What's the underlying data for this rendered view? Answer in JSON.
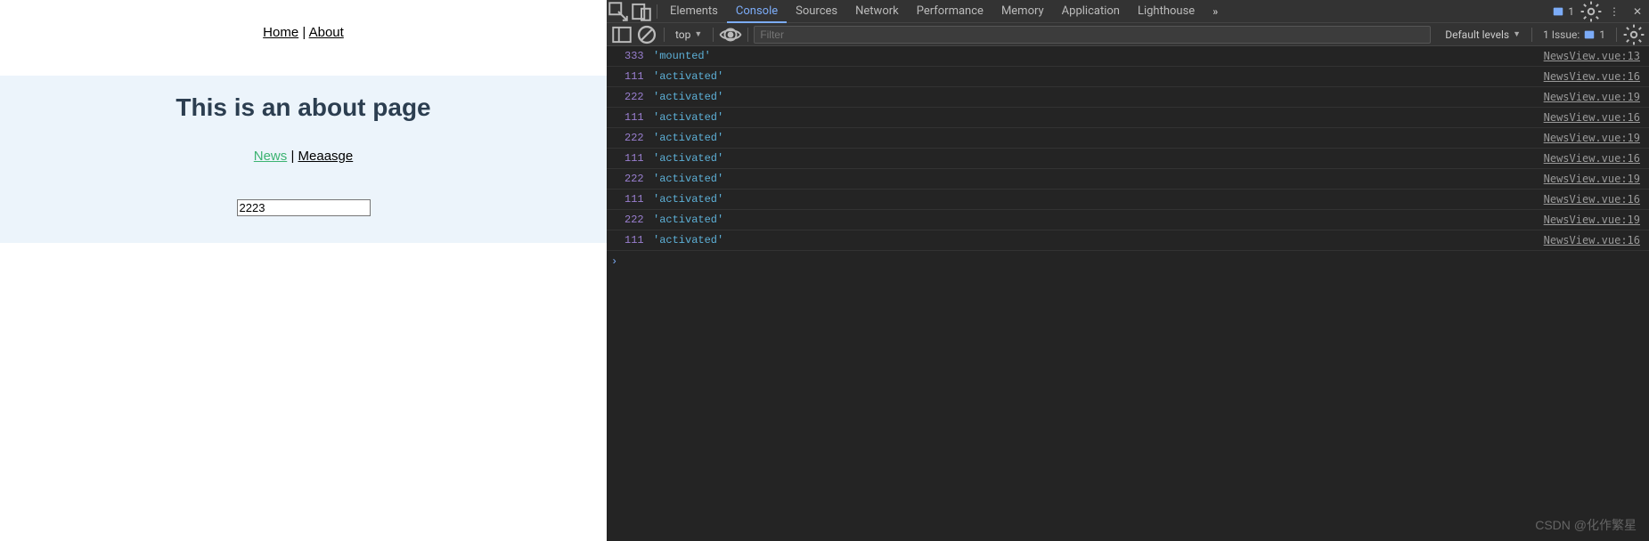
{
  "app": {
    "nav": {
      "home": "Home",
      "about": "About"
    },
    "title": "This is an about page",
    "subnav": {
      "news": "News",
      "message": "Meaasge"
    },
    "input_value": "2223"
  },
  "devtools": {
    "tabs": [
      "Elements",
      "Console",
      "Sources",
      "Network",
      "Performance",
      "Memory",
      "Application",
      "Lighthouse"
    ],
    "active_tab": "Console",
    "errors_badge": "1",
    "toolbar": {
      "context": "top",
      "filter_placeholder": "Filter",
      "levels": "Default levels",
      "issues_label": "1 Issue:",
      "issues_count": "1"
    },
    "logs": [
      {
        "num": "333",
        "str": "'mounted'",
        "src": "NewsView.vue:13"
      },
      {
        "num": "111",
        "str": "'activated'",
        "src": "NewsView.vue:16"
      },
      {
        "num": "222",
        "str": "'activated'",
        "src": "NewsView.vue:19"
      },
      {
        "num": "111",
        "str": "'activated'",
        "src": "NewsView.vue:16"
      },
      {
        "num": "222",
        "str": "'activated'",
        "src": "NewsView.vue:19"
      },
      {
        "num": "111",
        "str": "'activated'",
        "src": "NewsView.vue:16"
      },
      {
        "num": "222",
        "str": "'activated'",
        "src": "NewsView.vue:19"
      },
      {
        "num": "111",
        "str": "'activated'",
        "src": "NewsView.vue:16"
      },
      {
        "num": "222",
        "str": "'activated'",
        "src": "NewsView.vue:19"
      },
      {
        "num": "111",
        "str": "'activated'",
        "src": "NewsView.vue:16"
      }
    ]
  },
  "watermark": "CSDN @化作繁星"
}
